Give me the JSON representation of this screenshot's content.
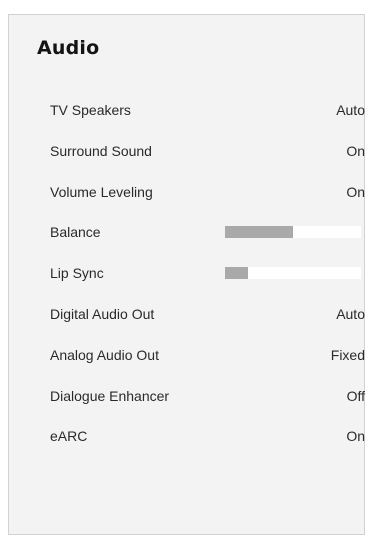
{
  "panel": {
    "title": "Audio"
  },
  "settings": [
    {
      "label": "TV Speakers",
      "value": "Auto"
    },
    {
      "label": "Surround Sound",
      "value": "On"
    },
    {
      "label": "Volume Leveling",
      "value": "On"
    },
    {
      "label": "Balance",
      "slider": 0.5
    },
    {
      "label": "Lip Sync",
      "slider": 0.17
    },
    {
      "label": "Digital Audio Out",
      "value": "Auto"
    },
    {
      "label": "Analog Audio Out",
      "value": "Fixed"
    },
    {
      "label": "Dialogue Enhancer",
      "value": "Off"
    },
    {
      "label": "eARC",
      "value": "On"
    }
  ],
  "colors": {
    "panel_bg": "#f3f3f3",
    "slider_track": "#ffffff",
    "slider_fill": "#a9a9a9",
    "text": "#2a2a2a"
  }
}
